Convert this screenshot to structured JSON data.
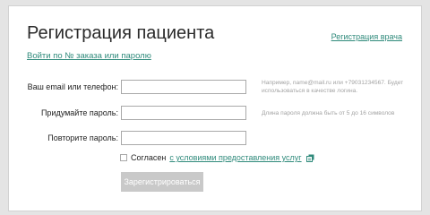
{
  "page": {
    "title": "Регистрация пациента",
    "doctor_registration_link": "Регистрация врача",
    "login_by_order_link": "Войти по № заказа или паролю"
  },
  "form": {
    "email": {
      "label": "Ваш email или телефон:",
      "value": "",
      "hint": "Например, name@mail.ru или +79031234567. Будет использоваться в качестве логина."
    },
    "password": {
      "label": "Придумайте пароль:",
      "value": "",
      "hint": "Длина пароля должна быть от 5 до 16 символов"
    },
    "repeat_password": {
      "label": "Повторите пароль:",
      "value": ""
    },
    "agree": {
      "checked": false,
      "prefix": "Согласен",
      "terms_link": "с условиями предоставления услуг",
      "icon": "document-icon"
    },
    "submit_label": "Зарегистрироваться"
  },
  "colors": {
    "accent": "#2f8a7b",
    "button_disabled": "#c9c9c9",
    "background": "#e4e4e4"
  }
}
